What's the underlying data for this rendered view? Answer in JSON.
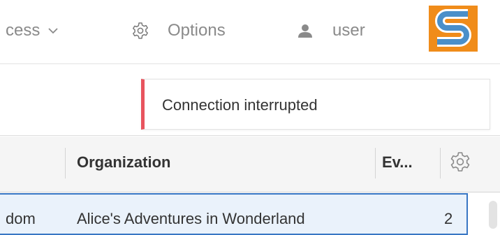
{
  "topbar": {
    "process_label": "cess",
    "options_label": "Options",
    "user_label": "user",
    "logo_letter": "S"
  },
  "toast": {
    "message": "Connection interrupted",
    "accent_color": "#e8545e"
  },
  "table": {
    "columns": [
      "Organization",
      "Ev..."
    ],
    "rows": [
      {
        "col0": "dom",
        "organization": "Alice's Adventures in Wonderland",
        "events": "2"
      }
    ]
  },
  "colors": {
    "brand_orange": "#f08c1a",
    "brand_blue": "#4a8fc9",
    "selected_border": "#3876c4",
    "selected_bg": "#eaf2fb"
  }
}
